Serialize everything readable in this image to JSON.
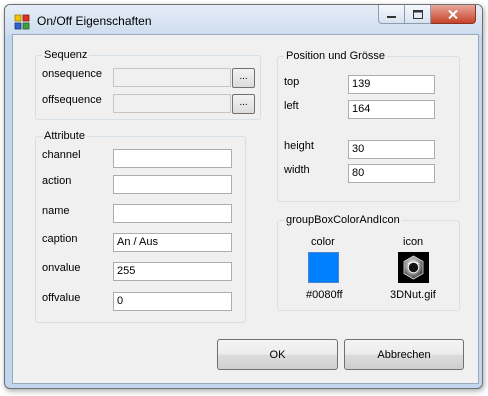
{
  "window": {
    "title": "On/Off Eigenschaften",
    "accent_color": "#c2d6ee"
  },
  "sequenz": {
    "title": "Sequenz",
    "onsequence_label": "onsequence",
    "onsequence_value": "",
    "onsequence_browse": "...",
    "offsequence_label": "offsequence",
    "offsequence_value": "",
    "offsequence_browse": "..."
  },
  "attribute": {
    "title": "Attribute",
    "channel_label": "channel",
    "channel_value": "",
    "action_label": "action",
    "action_value": "",
    "name_label": "name",
    "name_value": "",
    "caption_label": "caption",
    "caption_value": "An / Aus",
    "onvalue_label": "onvalue",
    "onvalue_value": "255",
    "offvalue_label": "offvalue",
    "offvalue_value": "0"
  },
  "position": {
    "title": "Position und Grösse",
    "top_label": "top",
    "top_value": "139",
    "left_label": "left",
    "left_value": "164",
    "height_label": "height",
    "height_value": "30",
    "width_label": "width",
    "width_value": "80"
  },
  "color_icon": {
    "title": "groupBoxColorAndIcon",
    "color_label": "color",
    "color_value": "#0080ff",
    "color_caption": "#0080ff",
    "icon_label": "icon",
    "icon_caption": "3DNut.gif"
  },
  "buttons": {
    "ok": "OK",
    "cancel": "Abbrechen"
  }
}
